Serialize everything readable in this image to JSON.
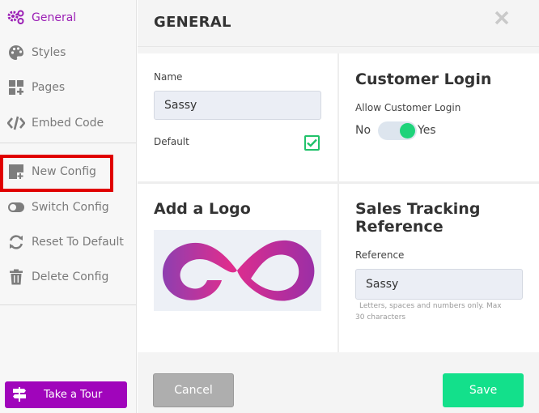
{
  "sidebar": {
    "items": [
      {
        "label": "General",
        "icon": "gears-icon",
        "active": true
      },
      {
        "label": "Styles",
        "icon": "palette-icon"
      },
      {
        "label": "Pages",
        "icon": "pages-grid-icon"
      },
      {
        "label": "Embed Code",
        "icon": "code-icon"
      },
      {
        "label": "New Config",
        "icon": "new-config-icon"
      },
      {
        "label": "Switch Config",
        "icon": "toggle-icon"
      },
      {
        "label": "Reset To Default",
        "icon": "sync-icon"
      },
      {
        "label": "Delete Config",
        "icon": "trash-icon"
      }
    ],
    "tour_label": "Take a Tour"
  },
  "header": {
    "title": "GENERAL"
  },
  "general": {
    "name_label": "Name",
    "name_value": "Sassy",
    "default_label": "Default",
    "default_checked": true
  },
  "customer_login": {
    "title": "Customer Login",
    "allow_label": "Allow Customer Login",
    "no_label": "No",
    "yes_label": "Yes",
    "enabled": true
  },
  "logo": {
    "title": "Add a Logo"
  },
  "sales_tracking": {
    "title_line1": "Sales Tracking",
    "title_line2": "Reference",
    "reference_label": "Reference",
    "reference_value": "Sassy",
    "hint_line1": "Letters, spaces and numbers only. Max",
    "hint_line2": "30 characters"
  },
  "footer": {
    "cancel_label": "Cancel",
    "save_label": "Save"
  },
  "colors": {
    "accent": "#9b1fb5",
    "tour_button": "#a005bb",
    "save_button": "#13e08b",
    "toggle_on": "#1ed37a",
    "checkbox": "#21c26a",
    "highlight": "#e00000"
  }
}
